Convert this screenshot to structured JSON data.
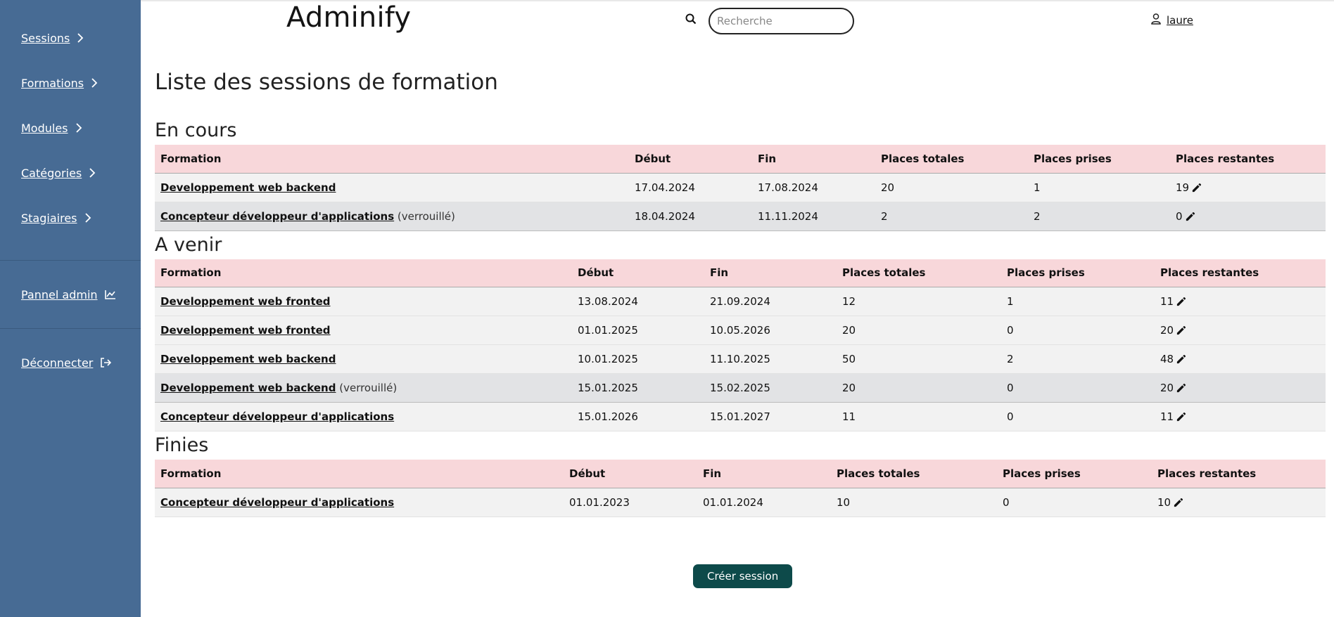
{
  "app": {
    "brand": "Adminify"
  },
  "sidebar": {
    "items": [
      {
        "label": "Sessions"
      },
      {
        "label": "Formations"
      },
      {
        "label": "Modules"
      },
      {
        "label": "Catégories"
      },
      {
        "label": "Stagiaires"
      }
    ],
    "admin_label": "Pannel admin",
    "logout_label": "Déconnecter"
  },
  "search": {
    "placeholder": "Recherche"
  },
  "user": {
    "name": "laure"
  },
  "page": {
    "title": "Liste des sessions de formation"
  },
  "columns": [
    "Formation",
    "Début",
    "Fin",
    "Places totales",
    "Places prises",
    "Places restantes"
  ],
  "locked_label": "(verrouillé)",
  "sections": [
    {
      "title": "En cours",
      "rows": [
        {
          "formation": "Developpement web backend",
          "locked": false,
          "debut": "17.04.2024",
          "fin": "17.08.2024",
          "totales": "20",
          "prises": "1",
          "restantes": "19"
        },
        {
          "formation": "Concepteur développeur d'applications",
          "locked": true,
          "debut": "18.04.2024",
          "fin": "11.11.2024",
          "totales": "2",
          "prises": "2",
          "restantes": "0"
        }
      ]
    },
    {
      "title": "A venir",
      "rows": [
        {
          "formation": "Developpement web fronted",
          "locked": false,
          "debut": "13.08.2024",
          "fin": "21.09.2024",
          "totales": "12",
          "prises": "1",
          "restantes": "11"
        },
        {
          "formation": "Developpement web fronted",
          "locked": false,
          "debut": "01.01.2025",
          "fin": "10.05.2026",
          "totales": "20",
          "prises": "0",
          "restantes": "20"
        },
        {
          "formation": "Developpement web backend",
          "locked": false,
          "debut": "10.01.2025",
          "fin": "11.10.2025",
          "totales": "50",
          "prises": "2",
          "restantes": "48"
        },
        {
          "formation": "Developpement web backend",
          "locked": true,
          "debut": "15.01.2025",
          "fin": "15.02.2025",
          "totales": "20",
          "prises": "0",
          "restantes": "20"
        },
        {
          "formation": "Concepteur développeur d'applications",
          "locked": false,
          "debut": "15.01.2026",
          "fin": "15.01.2027",
          "totales": "11",
          "prises": "0",
          "restantes": "11"
        }
      ]
    },
    {
      "title": "Finies",
      "rows": [
        {
          "formation": "Concepteur développeur d'applications",
          "locked": false,
          "debut": "01.01.2023",
          "fin": "01.01.2024",
          "totales": "10",
          "prises": "0",
          "restantes": "10"
        }
      ]
    }
  ],
  "actions": {
    "create_label": "Créer session"
  },
  "colors": {
    "sidebar": "#476b94",
    "table_header": "#f8d7da",
    "button": "#0d4a4a"
  }
}
